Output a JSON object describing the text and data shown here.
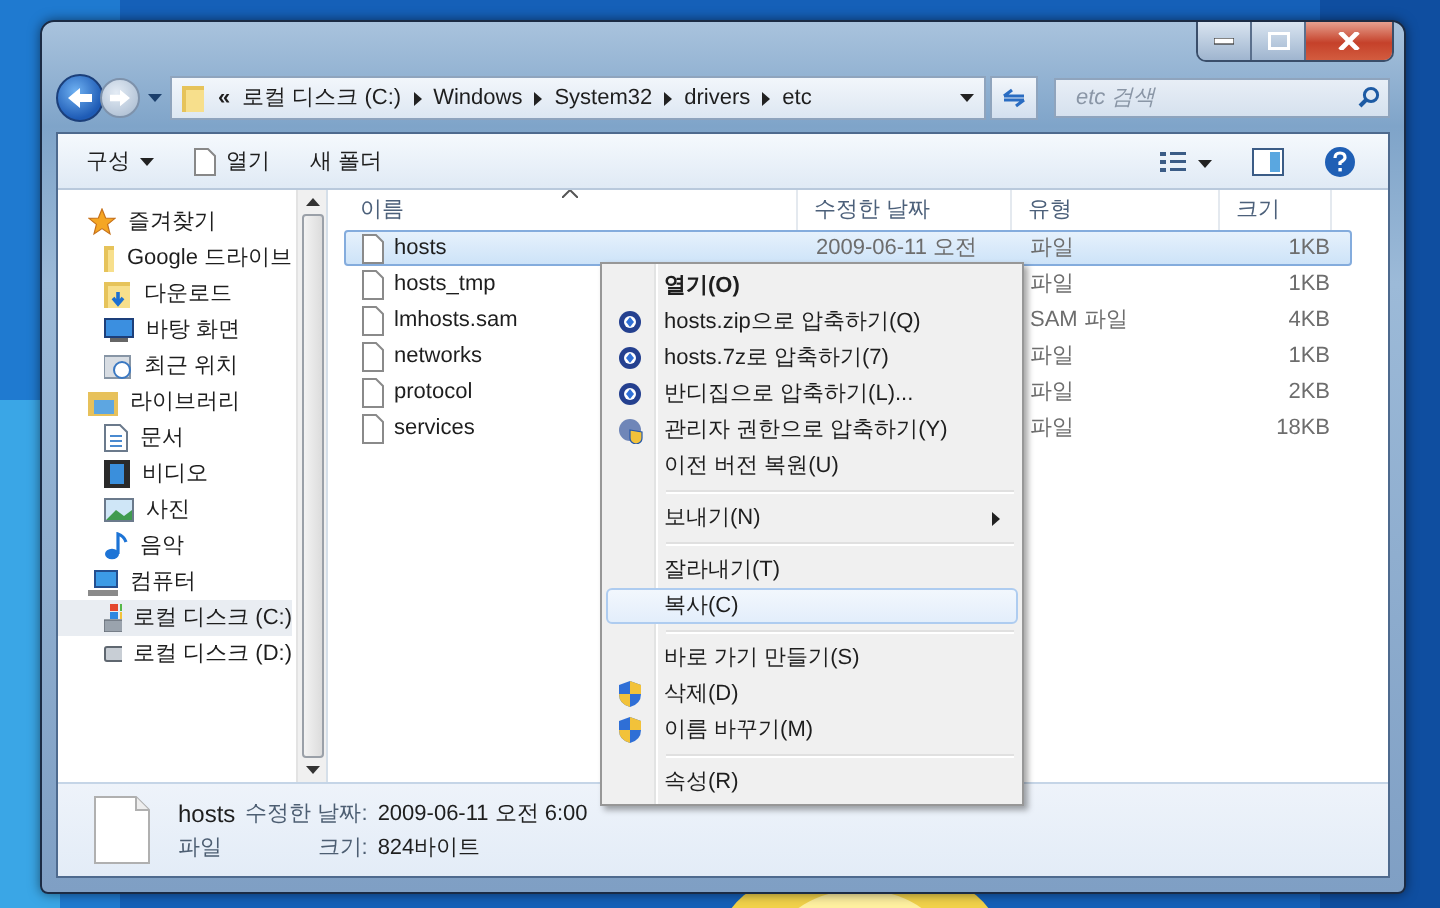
{
  "address_bar": {
    "overflow": "«",
    "path": [
      "로컬 디스크 (C:)",
      "Windows",
      "System32",
      "drivers",
      "etc"
    ]
  },
  "search": {
    "placeholder": "etc 검색"
  },
  "toolbar": {
    "items": [
      {
        "label": "구성",
        "kind": "menu"
      },
      {
        "label": "열기",
        "kind": "open"
      },
      {
        "label": "새 폴더",
        "kind": "plain"
      }
    ]
  },
  "sidebar": {
    "groups": [
      {
        "label": "즐겨찾기",
        "kind": "star",
        "children": [
          {
            "label": "Google 드라이브",
            "kind": "gdrive",
            "selected": false
          },
          {
            "label": "다운로드",
            "kind": "download",
            "selected": false
          },
          {
            "label": "바탕 화면",
            "kind": "desktop",
            "selected": false
          },
          {
            "label": "최근 위치",
            "kind": "recent",
            "selected": false
          }
        ]
      },
      {
        "label": "라이브러리",
        "kind": "library",
        "children": [
          {
            "label": "문서",
            "kind": "document",
            "selected": false
          },
          {
            "label": "비디오",
            "kind": "video",
            "selected": false
          },
          {
            "label": "사진",
            "selected": false
          },
          {
            "label": "음악",
            "kind": "music",
            "selected": false
          }
        ]
      },
      {
        "label": "컴퓨터",
        "kind": "computer",
        "children": [
          {
            "label": "로컬 디스크 (C:)",
            "kind": "drive-c",
            "selected": true
          },
          {
            "label": "로컬 디스크 (D:)",
            "kind": "drive",
            "selected": false
          }
        ]
      }
    ]
  },
  "file_list": {
    "columns": [
      "이름",
      "수정한 날짜",
      "유형",
      "크기"
    ],
    "rows": [
      {
        "name": "hosts",
        "date": "2009-06-11 오전",
        "type": "파일",
        "size": "1KB",
        "selected": true
      },
      {
        "name": "hosts_tmp",
        "type": "파일",
        "size": "1KB",
        "selected": false
      },
      {
        "name": "lmhosts.sam",
        "type": "SAM 파일",
        "size": "4KB",
        "selected": false
      },
      {
        "name": "networks",
        "type": "파일",
        "size": "1KB",
        "selected": false
      },
      {
        "name": "protocol",
        "type": "파일",
        "size": "2KB",
        "selected": false
      },
      {
        "name": "services",
        "type": "파일",
        "size": "18KB",
        "selected": false
      }
    ]
  },
  "context_menu": {
    "items": [
      {
        "label": "열기(O)",
        "kind": "default",
        "selected": false
      },
      {
        "label": "hosts.zip으로 압축하기(Q)",
        "kind": "archive",
        "selected": false
      },
      {
        "label": "hosts.7z로 압축하기(7)",
        "kind": "archive",
        "selected": false
      },
      {
        "label": "반디집으로 압축하기(L)...",
        "kind": "archive",
        "selected": false
      },
      {
        "label": "관리자 권한으로 압축하기(Y)",
        "kind": "admin-archive",
        "selected": false
      },
      {
        "label": "이전 버전 복원(U)",
        "kind": "plain",
        "selected": false
      },
      {
        "kind": "separator"
      },
      {
        "label": "보내기(N)",
        "kind": "submenu",
        "selected": false
      },
      {
        "kind": "separator"
      },
      {
        "label": "잘라내기(T)",
        "kind": "plain",
        "selected": false
      },
      {
        "label": "복사(C)",
        "kind": "plain",
        "selected": true
      },
      {
        "kind": "separator"
      },
      {
        "label": "바로 가기 만들기(S)",
        "kind": "plain",
        "selected": false
      },
      {
        "label": "삭제(D)",
        "kind": "shield",
        "selected": false
      },
      {
        "label": "이름 바꾸기(M)",
        "kind": "shield",
        "selected": false
      },
      {
        "kind": "separator"
      },
      {
        "label": "속성(R)",
        "kind": "plain",
        "selected": false
      }
    ]
  },
  "details": {
    "name": "hosts",
    "type": "파일",
    "fields": [
      {
        "label": "수정한 날짜:",
        "value": "2009-06-11 오전 6:00"
      },
      {
        "label": "크기:",
        "value": "824바이트"
      }
    ]
  }
}
